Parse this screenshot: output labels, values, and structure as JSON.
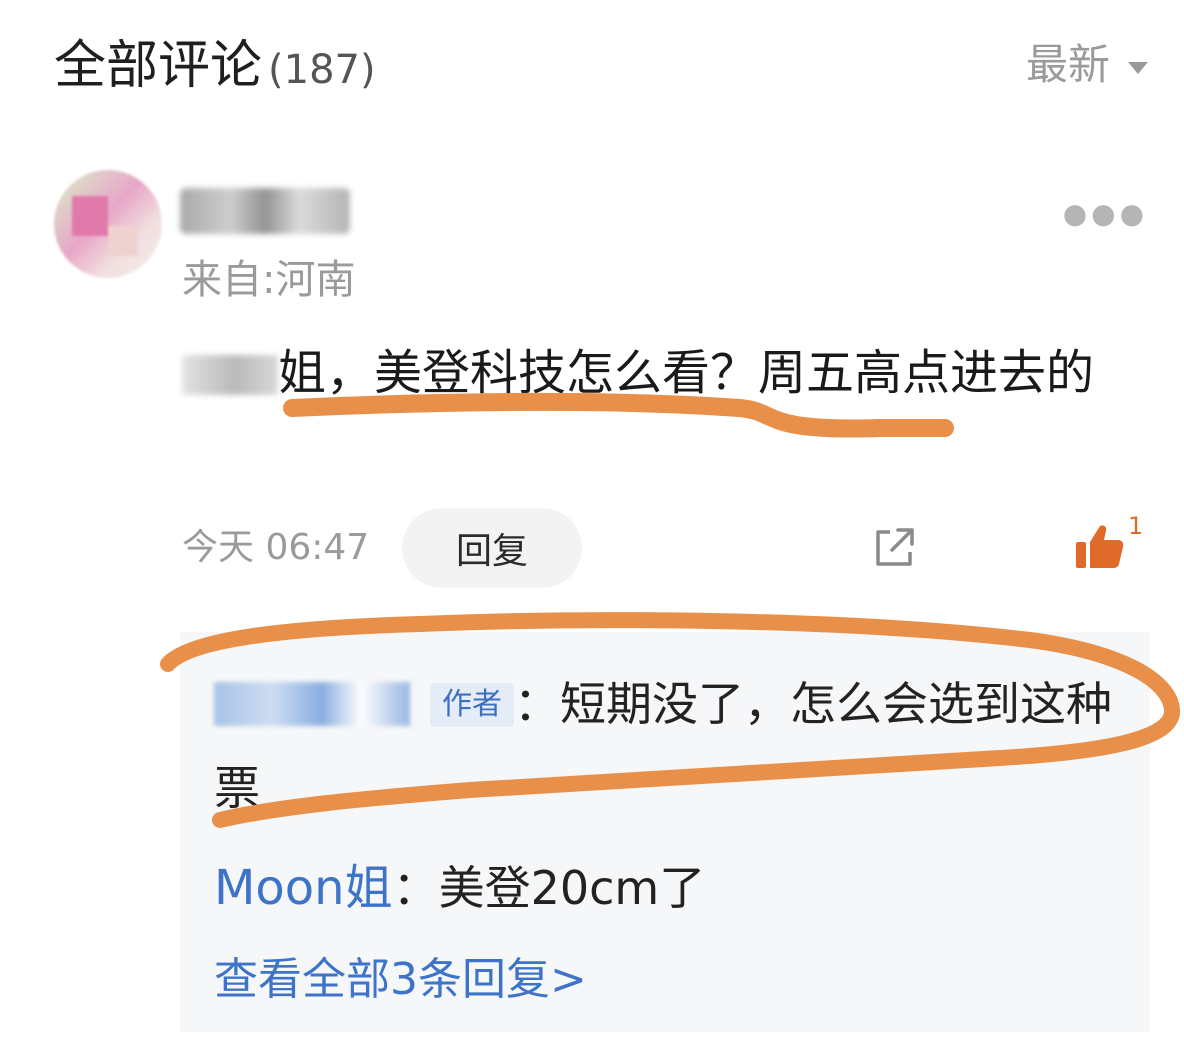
{
  "header": {
    "title": "全部评论",
    "count": "(187)",
    "sort_label": "最新"
  },
  "comment": {
    "location": "来自:河南",
    "text_after_mention": "姐，美登科技怎么看？周五高点进去的",
    "time": "今天 06:47",
    "reply_label": "回复",
    "like_count": "1"
  },
  "replies": {
    "items": [
      {
        "author_tag": "作者",
        "separator": "：",
        "text": "短期没了，怎么会选到这种票"
      },
      {
        "name": "Moon姐",
        "separator": "：",
        "text": "美登20cm了"
      }
    ],
    "view_all": "查看全部3条回复>"
  },
  "colors": {
    "accent_blue": "#3d74c8",
    "annotation_orange": "#e8904a",
    "like_orange": "#e06a2a"
  },
  "icons": {
    "sort": "caret-down-icon",
    "more": "more-dots-icon",
    "share": "share-icon",
    "like": "thumbs-up-icon"
  }
}
